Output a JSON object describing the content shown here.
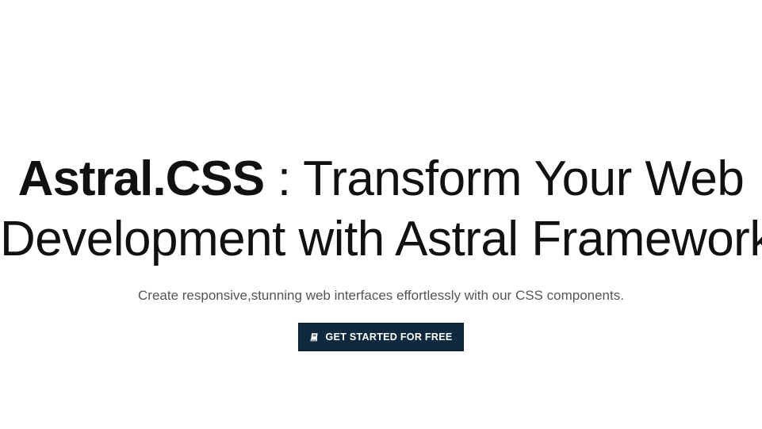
{
  "hero": {
    "brand": "Astral.CSS",
    "title_line1_rest": " : Transform Your Web",
    "title_line2": "Development with Astral Framework",
    "subtitle": "Create responsive,stunning web interfaces effortlessly with our CSS components.",
    "cta_label": "GET STARTED FOR FREE",
    "cta_icon": "book-icon"
  },
  "colors": {
    "background": "#ffffff",
    "text": "#111111",
    "subtitle": "#555555",
    "button_bg": "#0f2a3f",
    "button_text": "#ffffff"
  }
}
